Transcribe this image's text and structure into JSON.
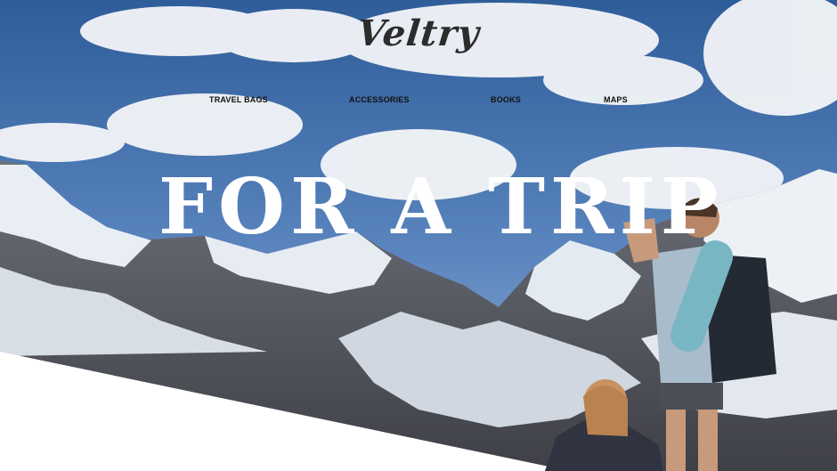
{
  "logo": {
    "text": "Veltry"
  },
  "nav": {
    "items": [
      {
        "label": "TRAVEL BAGS"
      },
      {
        "label": "ACCESSORIES"
      },
      {
        "label": "BOOKS"
      },
      {
        "label": "MAPS"
      }
    ]
  },
  "hero": {
    "headline": "FOR A TRIP"
  },
  "colors": {
    "sky": "#3d6aa6",
    "snow": "#eef2f6",
    "rock": "#5f5f66",
    "headline": "#ffffff",
    "text": "#111111"
  },
  "icons": [
    "mountains-photo",
    "hiker-with-backpack",
    "seated-hiker"
  ]
}
